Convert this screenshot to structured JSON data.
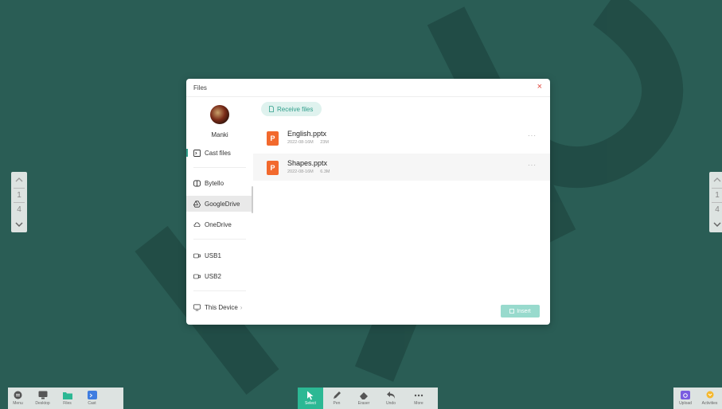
{
  "dialog": {
    "title": "Files",
    "close": "×",
    "user": {
      "name": "Manki"
    },
    "sidebar": [
      {
        "label": "Cast files",
        "icon": "cast-files-icon"
      },
      {
        "label": "Bytello",
        "icon": "bytello-icon"
      },
      {
        "label": "GoogleDrive",
        "icon": "google-drive-icon"
      },
      {
        "label": "OneDrive",
        "icon": "cloud-icon"
      },
      {
        "label": "USB1",
        "icon": "usb-icon"
      },
      {
        "label": "USB2",
        "icon": "usb-icon"
      },
      {
        "label": "This Device",
        "icon": "monitor-icon",
        "suffix": "›"
      }
    ],
    "receive_label": "Receive files",
    "files": [
      {
        "name": "English.pptx",
        "date": "2022-08-16M",
        "size": "23M",
        "icon_letter": "P"
      },
      {
        "name": "Shapes.pptx",
        "date": "2022-08-16M",
        "size": "6.3M",
        "icon_letter": "P"
      }
    ],
    "more": "···",
    "insert_label": "Insert"
  },
  "pagenav_left": {
    "current": "1",
    "total": "4"
  },
  "pagenav_right": {
    "current": "1",
    "total": "4"
  },
  "toolbar_left": [
    {
      "label": "Menu",
      "icon": "menu-icon"
    },
    {
      "label": "Desktop",
      "icon": "desktop-icon"
    },
    {
      "label": "Files",
      "icon": "folder-icon"
    },
    {
      "label": "Cast",
      "icon": "cast-icon"
    }
  ],
  "toolbar_center": [
    {
      "label": "Select",
      "icon": "cursor-icon",
      "selected": true
    },
    {
      "label": "Pen",
      "icon": "pen-icon"
    },
    {
      "label": "Eraser",
      "icon": "eraser-icon"
    },
    {
      "label": "Undo",
      "icon": "undo-icon"
    },
    {
      "label": "More",
      "icon": "more-icon"
    }
  ],
  "toolbar_right": [
    {
      "label": "Upload",
      "icon": "camera-icon"
    },
    {
      "label": "Activities",
      "icon": "activities-icon"
    }
  ],
  "colors": {
    "background": "#2a5d55",
    "accent": "#2cb894",
    "ppt": "#f2692d",
    "close": "#e0463c"
  }
}
